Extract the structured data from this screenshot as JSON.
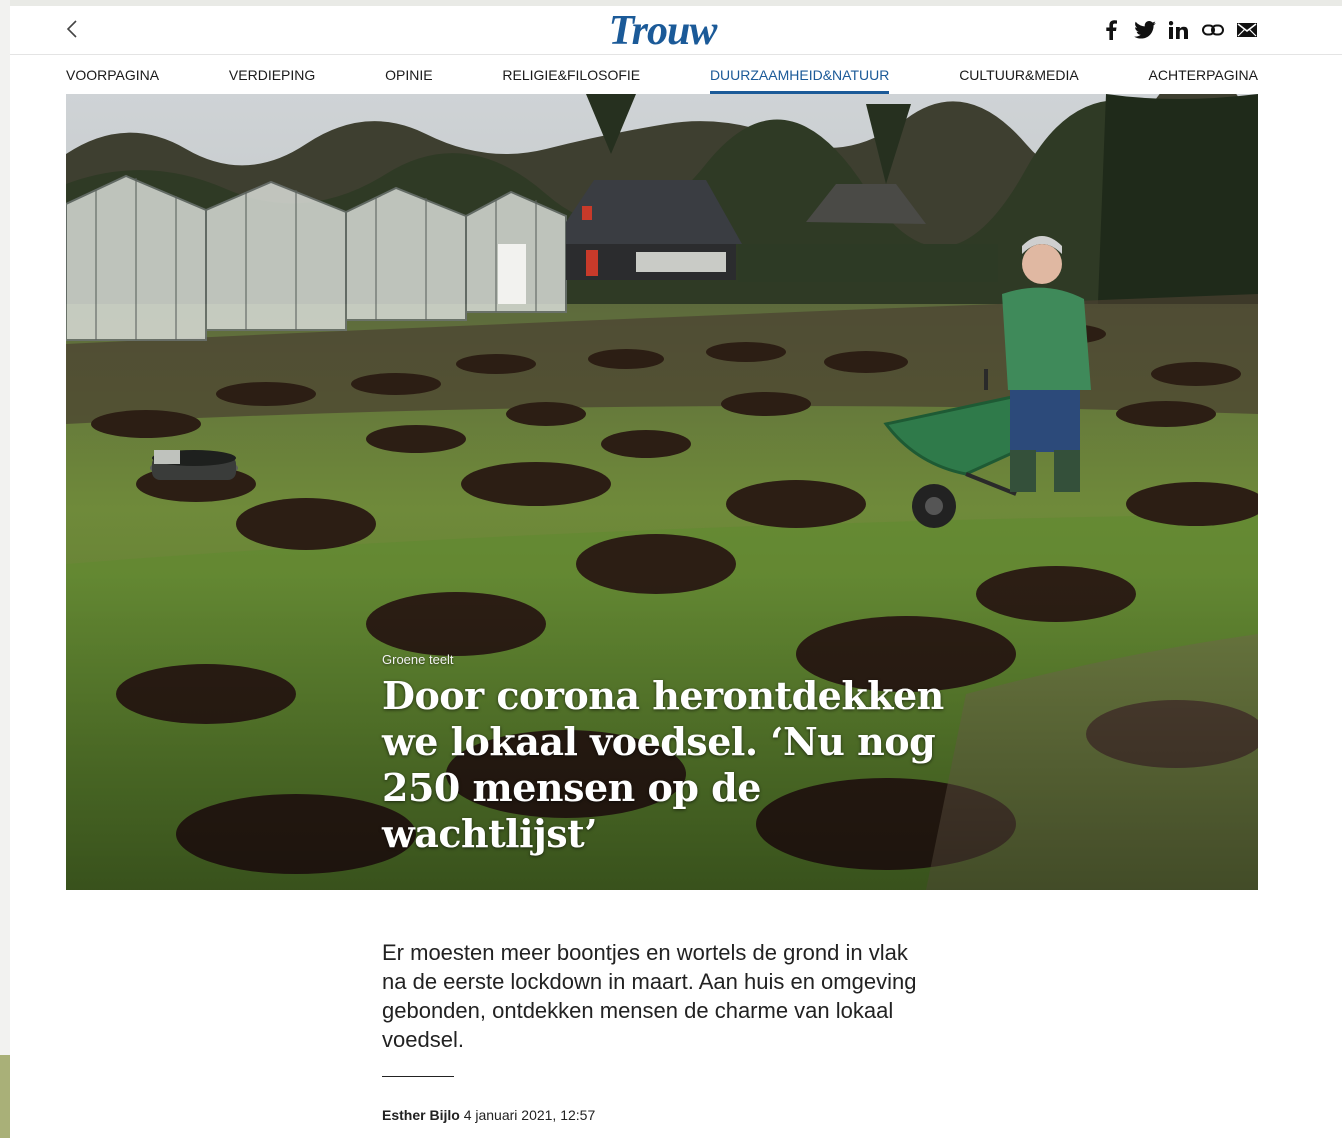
{
  "header": {
    "logo_text": "Trouw",
    "brand_color": "#1b5a98",
    "back_icon": "chevron-left-icon",
    "share_icons": [
      "facebook-icon",
      "twitter-icon",
      "linkedin-icon",
      "link-icon",
      "mail-icon"
    ]
  },
  "nav": {
    "items": [
      {
        "label": "VOORPAGINA",
        "active": false
      },
      {
        "label": "VERDIEPING",
        "active": false
      },
      {
        "label": "OPINIE",
        "active": false
      },
      {
        "label": "RELIGIE&FILOSOFIE",
        "active": false
      },
      {
        "label": "DUURZAAMHEID&NATUUR",
        "active": true
      },
      {
        "label": "CULTUUR&MEDIA",
        "active": false
      },
      {
        "label": "ACHTERPAGINA",
        "active": false
      }
    ]
  },
  "article": {
    "kicker": "Groene teelt",
    "headline": "Door corona herontdekken we lokaal voedsel. ‘Nu nog 250 mensen op de wachtlijst’",
    "intro": "Er moesten meer boontjes en wortels de grond in vlak na de eerste lockdown in maart. Aan huis en omgeving gebonden, ontdekken mensen de charme van lokaal voedsel.",
    "author": "Esther Bijlo",
    "date": "4 januari 2021, 12:57"
  }
}
